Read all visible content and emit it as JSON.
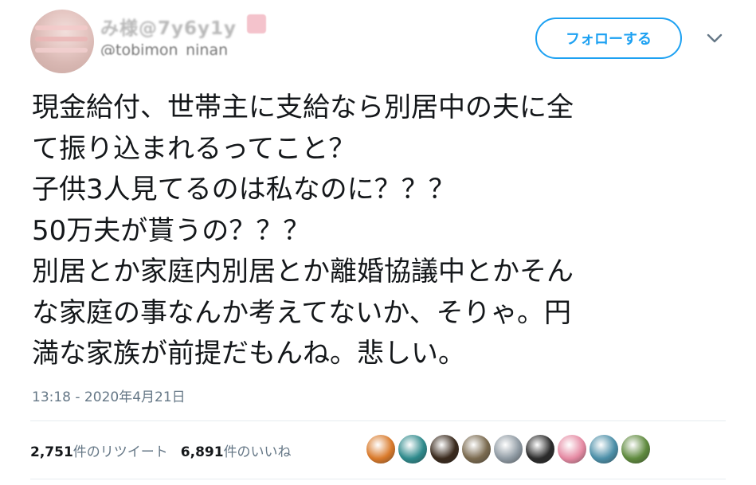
{
  "user": {
    "display_name": "み様@7y6y1y",
    "handle": "@tobimon_ninan"
  },
  "follow_button": {
    "label": "フォローする"
  },
  "tweet": {
    "text": "現金給付、世帯主に支給なら別居中の夫に全\nて振り込まれるってこと？\n子供3人見てるのは私なのに？？？\n50万夫が貰うの？？？\n別居とか家庭内別居とか離婚協議中とかそん\nな家庭の事なんか考えてないか、そりゃ。円\n満な家族が前提だもんね。悲しい。",
    "timestamp": "13:18 - 2020年4月21日"
  },
  "stats": {
    "retweets_count": "2,751",
    "retweets_label": "件のリツイート",
    "likes_count": "6,891",
    "likes_label": "件のいいね"
  },
  "liker_avatars": [
    {
      "color": "#d97a2b",
      "icon": "avatar-1"
    },
    {
      "color": "#2f8a8c",
      "icon": "avatar-2"
    },
    {
      "color": "#3a2a1d",
      "icon": "avatar-3"
    },
    {
      "color": "#7a6a4f",
      "icon": "avatar-4"
    },
    {
      "color": "#8f9aa3",
      "icon": "avatar-5"
    },
    {
      "color": "#2b2b2b",
      "icon": "avatar-6"
    },
    {
      "color": "#e58aa3",
      "icon": "avatar-7"
    },
    {
      "color": "#4c8fa8",
      "icon": "avatar-8"
    },
    {
      "color": "#5f8a3e",
      "icon": "avatar-9"
    }
  ],
  "colors": {
    "accent": "#1da1f2",
    "text": "#14171a",
    "muted": "#657786",
    "divider": "#e6ecf0"
  }
}
